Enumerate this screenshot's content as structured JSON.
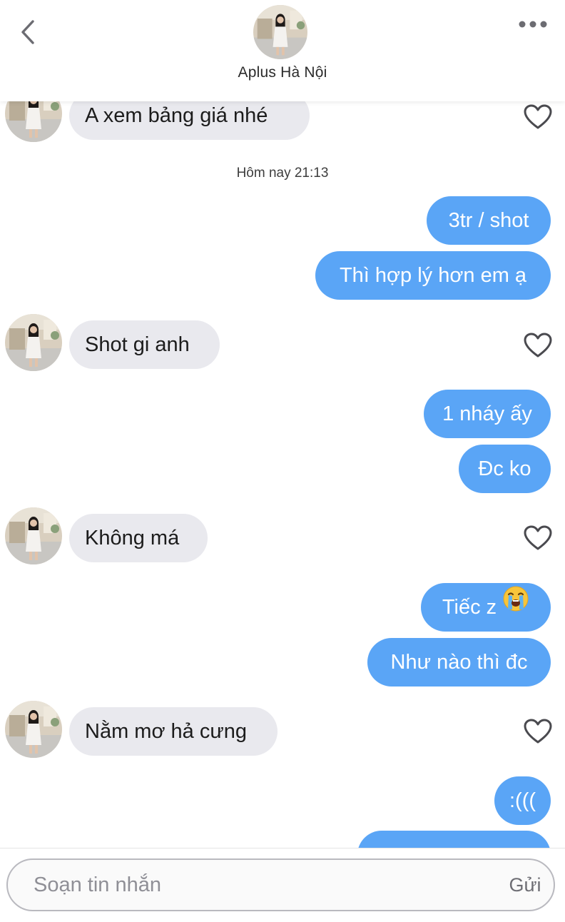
{
  "header": {
    "contact_name": "Aplus Hà Nội"
  },
  "timestamp": "Hôm nay 21:13",
  "messages": [
    {
      "side": "in",
      "text": "A xem bảng giá nhé"
    },
    {
      "side": "out",
      "text": "3tr / shot"
    },
    {
      "side": "out",
      "text": "Thì hợp lý hơn em ạ"
    },
    {
      "side": "in",
      "text": "Shot gi anh"
    },
    {
      "side": "out",
      "text": "1 nháy ấy"
    },
    {
      "side": "out",
      "text": "Đc ko"
    },
    {
      "side": "in",
      "text": "Không má"
    },
    {
      "side": "out",
      "text": "Tiếc z",
      "emoji": "loudly-crying-face"
    },
    {
      "side": "out",
      "text": "Như nào thì đc"
    },
    {
      "side": "in",
      "text": "Nằm mơ hả cưng"
    },
    {
      "side": "out",
      "text": ":((("
    }
  ],
  "composer": {
    "placeholder": "Soạn tin nhắn",
    "send_label": "Gửi"
  },
  "colors": {
    "outgoing_bubble": "#5aa5f6",
    "incoming_bubble": "#e9e9ee",
    "background": "#ffffff"
  }
}
